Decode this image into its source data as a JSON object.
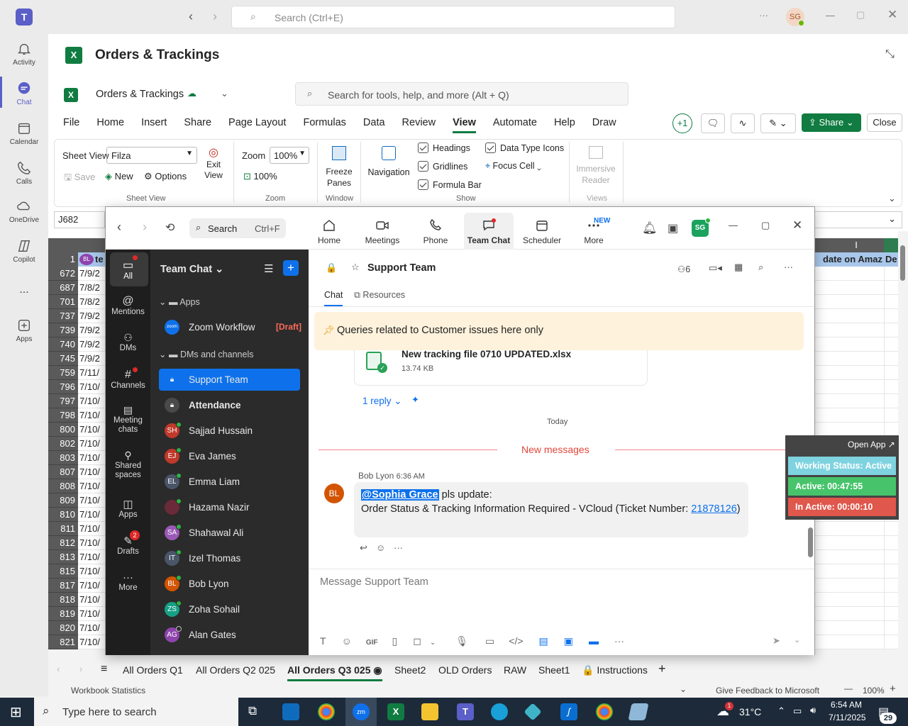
{
  "teams": {
    "search_placeholder": "Search (Ctrl+E)",
    "user_initials": "SG",
    "rail": [
      {
        "label": "Activity",
        "icon": "bell-icon"
      },
      {
        "label": "Chat",
        "icon": "chat-icon"
      },
      {
        "label": "Calendar",
        "icon": "calendar-icon"
      },
      {
        "label": "Calls",
        "icon": "phone-icon"
      },
      {
        "label": "OneDrive",
        "icon": "cloud-icon"
      },
      {
        "label": "Copilot",
        "icon": "copilot-icon"
      },
      {
        "label": "...",
        "icon": "more-icon"
      },
      {
        "label": "Apps",
        "icon": "apps-icon"
      }
    ]
  },
  "excel": {
    "title": "Orders & Trackings",
    "doc_name": "Orders & Trackings",
    "search_placeholder": "Search for tools, help, and more (Alt + Q)",
    "menu": [
      "File",
      "Home",
      "Insert",
      "Share",
      "Page Layout",
      "Formulas",
      "Data",
      "Review",
      "View",
      "Automate",
      "Help",
      "Draw"
    ],
    "plus_one": "+1",
    "share_label": "Share",
    "close_label": "Close",
    "ribbon": {
      "sheet_view_label": "Sheet View",
      "sheet_view_value": "Filza",
      "save": "Save",
      "new": "New",
      "options": "Options",
      "exit_view": "Exit View",
      "group_sheet_view": "Sheet View",
      "zoom_label": "Zoom",
      "zoom_value": "100%",
      "zoom_100": "100%",
      "group_zoom": "Zoom",
      "freeze_panes": "Freeze Panes",
      "group_window": "Window",
      "navigation": "Navigation",
      "headings": "Headings",
      "gridlines": "Gridlines",
      "formula_bar": "Formula Bar",
      "data_type_icons": "Data Type Icons",
      "focus_cell": "Focus Cell",
      "group_show": "Show",
      "immersive_reader": "Immersive Reader",
      "group_views": "Views"
    },
    "name_box": "J682",
    "col_i_header": "I",
    "header_cell_1": "date on Amaz",
    "header_cell_2": "De",
    "row_header_first": "1",
    "header_col_b": "te",
    "rows": [
      {
        "num": "672",
        "val": "7/9/2"
      },
      {
        "num": "687",
        "val": "7/8/2"
      },
      {
        "num": "701",
        "val": "7/8/2"
      },
      {
        "num": "737",
        "val": "7/9/2"
      },
      {
        "num": "739",
        "val": "7/9/2"
      },
      {
        "num": "740",
        "val": "7/9/2"
      },
      {
        "num": "745",
        "val": "7/9/2"
      },
      {
        "num": "759",
        "val": "7/11/"
      },
      {
        "num": "796",
        "val": "7/10/"
      },
      {
        "num": "797",
        "val": "7/10/"
      },
      {
        "num": "798",
        "val": "7/10/"
      },
      {
        "num": "800",
        "val": "7/10/"
      },
      {
        "num": "802",
        "val": "7/10/"
      },
      {
        "num": "803",
        "val": "7/10/"
      },
      {
        "num": "807",
        "val": "7/10/"
      },
      {
        "num": "808",
        "val": "7/10/"
      },
      {
        "num": "809",
        "val": "7/10/"
      },
      {
        "num": "810",
        "val": "7/10/"
      },
      {
        "num": "811",
        "val": "7/10/"
      },
      {
        "num": "812",
        "val": "7/10/"
      },
      {
        "num": "813",
        "val": "7/10/"
      },
      {
        "num": "815",
        "val": "7/10/"
      },
      {
        "num": "817",
        "val": "7/10/"
      },
      {
        "num": "818",
        "val": "7/10/"
      },
      {
        "num": "819",
        "val": "7/10/"
      },
      {
        "num": "820",
        "val": "7/10/"
      },
      {
        "num": "821",
        "val": "7/10/"
      }
    ],
    "sheet_tabs": [
      "All Orders Q1",
      "All Orders Q2 025",
      "All Orders Q3 025",
      "Sheet2",
      "OLD Orders",
      "RAW",
      "Sheet1",
      "Instructions"
    ],
    "active_tab": "All Orders Q3 025",
    "status_left": "Workbook Statistics",
    "status_feedback": "Give Feedback to Microsoft",
    "status_zoom": "100%"
  },
  "zoom": {
    "search_label": "Search",
    "search_shortcut": "Ctrl+F",
    "tabs": [
      "Home",
      "Meetings",
      "Phone",
      "Team Chat",
      "Scheduler",
      "More"
    ],
    "new_badge": "NEW",
    "avatar": "SG",
    "nav": [
      {
        "label": "All",
        "icon": "chat-bubble-icon"
      },
      {
        "label": "Mentions",
        "icon": "at-icon"
      },
      {
        "label": "DMs",
        "icon": "people-icon"
      },
      {
        "label": "Channels",
        "icon": "hash-icon"
      },
      {
        "label": "Meeting chats",
        "icon": "calendar-icon"
      },
      {
        "label": "Shared spaces",
        "icon": "shared-icon"
      },
      {
        "label": "Apps",
        "icon": "apps-icon"
      },
      {
        "label": "Drafts",
        "icon": "drafts-icon"
      },
      {
        "label": "More",
        "icon": "more-icon"
      }
    ],
    "drafts_badge": "2",
    "list_title": "Team Chat",
    "section_apps": "Apps",
    "zoom_workflow": "Zoom Workflow",
    "draft_tag": "[Draft]",
    "section_dms": "DMs and channels",
    "channels": [
      {
        "name": "Support Team",
        "initials": "",
        "color": "#0e71eb",
        "bold": false
      },
      {
        "name": "Attendance",
        "initials": "",
        "color": "#555555",
        "bold": true
      },
      {
        "name": "Sajjad Hussain",
        "initials": "SH",
        "color": "#c0392b",
        "bold": false
      },
      {
        "name": "Eva James",
        "initials": "EJ",
        "color": "#c0392b",
        "bold": false
      },
      {
        "name": "Emma Liam",
        "initials": "EL",
        "color": "#4a5568",
        "bold": false
      },
      {
        "name": "Hazama Nazir",
        "initials": "",
        "color": "#6b2a3a",
        "bold": false
      },
      {
        "name": "Shahawal Ali",
        "initials": "SA",
        "color": "#9b59b6",
        "bold": false
      },
      {
        "name": "Izel Thomas",
        "initials": "IT",
        "color": "#4a5568",
        "bold": false
      },
      {
        "name": "Bob Lyon",
        "initials": "BL",
        "color": "#d35400",
        "bold": false
      },
      {
        "name": "Zoha Sohail",
        "initials": "ZS",
        "color": "#16a085",
        "bold": false
      },
      {
        "name": "Alan Gates",
        "initials": "AG",
        "color": "#8e44ad",
        "bold": false
      }
    ],
    "chat_title": "Support Team",
    "member_count": "6",
    "sub_tabs": [
      "Chat",
      "Resources"
    ],
    "pinned": "Queries related to Customer issues here only",
    "file_name": "New tracking file 0710 UPDATED.xlsx",
    "file_size": "13.74 KB",
    "reply_label": "1 reply",
    "today": "Today",
    "new_messages": "New messages",
    "msg_sender": "Bob Lyon",
    "msg_time": "6:36 AM",
    "msg_initials": "BL",
    "mention": "@Sophia Grace",
    "msg_line1": " pls update:",
    "msg_line2": "Order Status & Tracking Information Required - VCloud (Ticket Number: ",
    "ticket": "21878126",
    "msg_close": ")",
    "composer_placeholder": "Message Support Team"
  },
  "status_widget": {
    "open_app": "Open App",
    "working": "Working Status: Active",
    "active": "Active: 00:47:55",
    "inactive": "In Active: 00:00:10"
  },
  "taskbar": {
    "search_placeholder": "Type here to search",
    "temperature": "31°C",
    "time": "6:54 AM",
    "date": "7/11/2025",
    "notification_count": "29",
    "weather_badge": "1"
  }
}
